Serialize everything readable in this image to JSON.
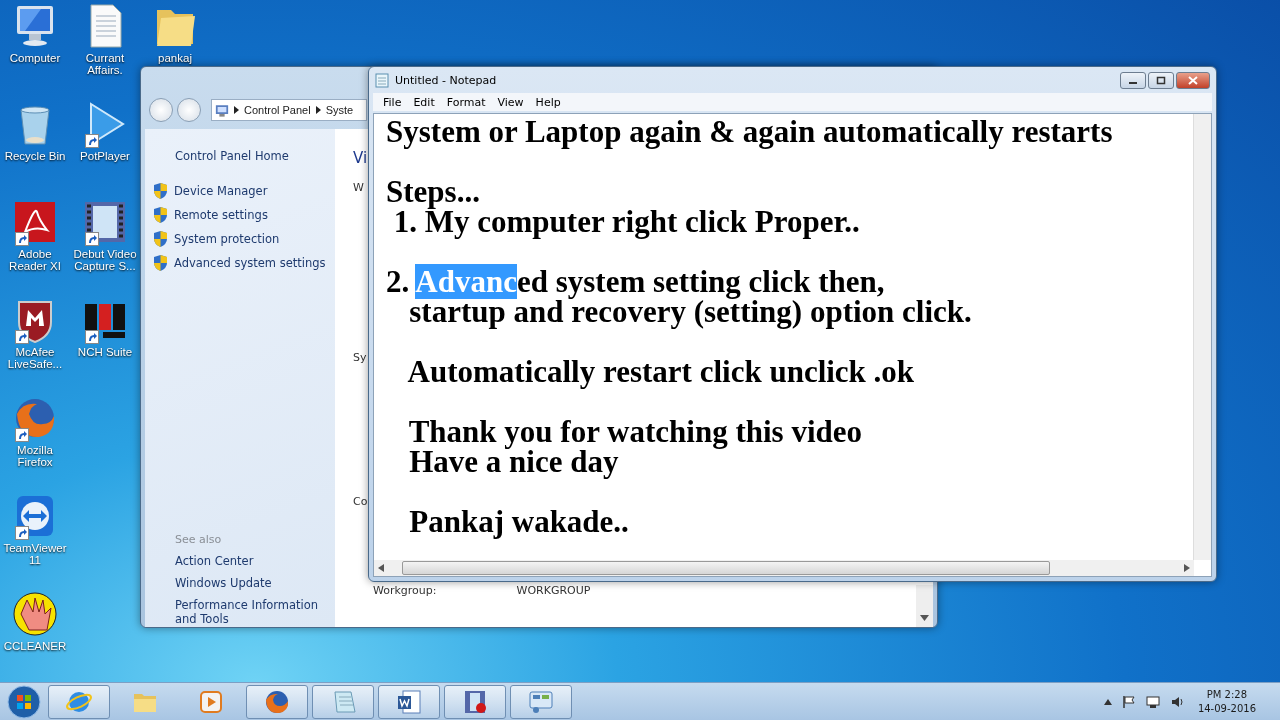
{
  "desktop_icons": [
    [
      {
        "label": "Computer",
        "kind": "computer",
        "shortcut": false
      },
      {
        "label": "Recycle Bin",
        "kind": "bin",
        "shortcut": false
      },
      {
        "label": "Adobe Reader XI",
        "kind": "pdf",
        "shortcut": true
      },
      {
        "label": "McAfee LiveSafe...",
        "kind": "shield",
        "shortcut": true
      },
      {
        "label": "Mozilla Firefox",
        "kind": "fox",
        "shortcut": true
      },
      {
        "label": "TeamViewer 11",
        "kind": "arrows",
        "shortcut": true
      },
      {
        "label": "CCLEANER",
        "kind": "hand",
        "shortcut": false
      }
    ],
    [
      {
        "label": "Currant Affairs.",
        "kind": "document",
        "shortcut": false
      },
      {
        "label": "PotPlayer",
        "kind": "play",
        "shortcut": true
      },
      {
        "label": "Debut Video Capture S...",
        "kind": "film",
        "shortcut": true
      },
      {
        "label": "NCH Suite",
        "kind": "blocks",
        "shortcut": true
      }
    ],
    [
      {
        "label": "pankaj",
        "kind": "folder",
        "shortcut": false
      }
    ]
  ],
  "control_panel": {
    "breadcrumb": [
      "Control Panel",
      "Syste"
    ],
    "nav_home": "Control Panel Home",
    "tasks": [
      "Device Manager",
      "Remote settings",
      "System protection",
      "Advanced system settings"
    ],
    "see_also_heading": "See also",
    "see_also": [
      "Action Center",
      "Windows Update",
      "Performance Information and Tools"
    ],
    "content": [
      {
        "kind": "heading",
        "text": "Vi"
      },
      {
        "kind": "label",
        "text": "W"
      },
      {
        "kind": "label",
        "text": "Sy"
      },
      {
        "kind": "label",
        "text": "Co"
      }
    ],
    "workgroup": {
      "label": "Workgroup:",
      "value": "WORKGROUP"
    }
  },
  "notepad": {
    "title": "Untitled - Notepad",
    "menu": [
      "File",
      "Edit",
      "Format",
      "View",
      "Help"
    ],
    "paragraphs": [
      [
        {
          "kind": "plain",
          "text": "System or Laptop again & again automatically restarts"
        }
      ],
      [
        {
          "kind": "plain",
          "text": "Steps..."
        },
        {
          "kind": "plain",
          "text": " 1. My computer right click Proper.."
        }
      ],
      [
        {
          "kind": "parts",
          "parts": [
            {
              "text": "2. ",
              "selected": false
            },
            {
              "text": "Advanc",
              "selected": true
            },
            {
              "text": "ed system setting click then,",
              "selected": false
            }
          ]
        },
        {
          "kind": "plain",
          "text": "   startup and recovery (setting) option click."
        }
      ],
      [
        {
          "kind": "plain",
          "text": "   Automatically restart click unclick .ok"
        }
      ],
      [
        {
          "kind": "plain",
          "text": "   Thank you for watching this video"
        },
        {
          "kind": "plain",
          "text": "   Have a nice day"
        }
      ],
      [
        {
          "kind": "plain",
          "text": "   Pankaj wakade.."
        }
      ]
    ]
  },
  "taskbar": {
    "apps": [
      {
        "kind": "globe",
        "running": true
      },
      {
        "kind": "folder",
        "running": false
      },
      {
        "kind": "media",
        "running": false
      },
      {
        "kind": "fox",
        "running": true
      },
      {
        "kind": "pad",
        "running": true
      },
      {
        "kind": "word",
        "running": true
      },
      {
        "kind": "film",
        "running": true
      },
      {
        "kind": "panel",
        "running": true
      }
    ],
    "clock": {
      "time": "PM 2:28",
      "date": "14-09-2016"
    }
  }
}
